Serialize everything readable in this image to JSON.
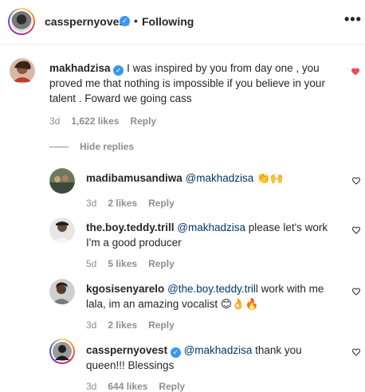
{
  "header": {
    "username": "casspernyovest",
    "dot": "•",
    "following": "Following",
    "more": "•••"
  },
  "comment": {
    "username": "makhadzisa",
    "text": " I was inspired by you from day one , you proved me that nothing is impossible if you believe in your talent . Foward we going cass",
    "time": "3d",
    "likes": "1,622 likes",
    "reply": "Reply",
    "liked": true
  },
  "hide_replies": "Hide replies",
  "replies": [
    {
      "username": "madibamusandiwa",
      "mention": "@makhadzisa",
      "text": " 👏🙌",
      "time": "3d",
      "likes": "2 likes",
      "reply": "Reply"
    },
    {
      "username": "the.boy.teddy.trill",
      "mention": "@makhadzisa",
      "text": " please let's work I'm a good producer",
      "time": "5d",
      "likes": "5 likes",
      "reply": "Reply"
    },
    {
      "username": "kgosisenyarelo",
      "mention": "@the.boy.teddy.trill",
      "text": " work with me lala, im an amazing vocalist 😊👌🔥",
      "time": "3d",
      "likes": "2 likes",
      "reply": "Reply"
    },
    {
      "username": "casspernyovest",
      "mention": "@makhadzisa",
      "text": " thank you queen!!! Blessings",
      "time": "3d",
      "likes": "644 likes",
      "reply": "Reply"
    }
  ],
  "colors": {
    "verified": "#3897f0",
    "like_red": "#ed4956",
    "mention": "#00376b",
    "muted": "#8e8e8e"
  },
  "icons": {
    "verified": "verified-badge-icon",
    "heart_filled": "heart-filled-icon",
    "heart_outline": "heart-outline-icon",
    "more": "more-options-icon"
  }
}
